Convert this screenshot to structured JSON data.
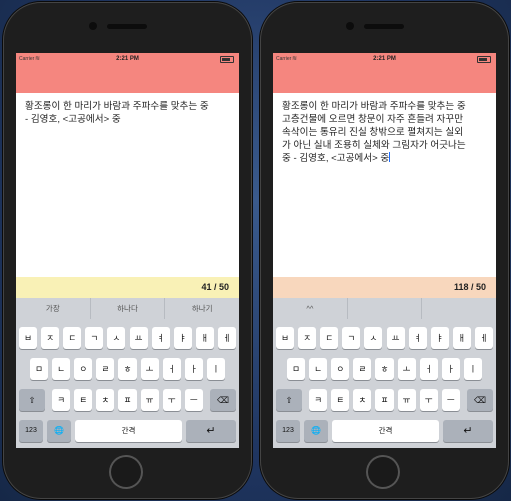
{
  "phones": [
    {
      "status": {
        "carrier": "Carrier",
        "time": "2:21 PM"
      },
      "text": "황조롱이 한 마리가 바람과 주파수를 맞추는 중\n- 김영호, <고공에서> 중",
      "counter": "41 / 50",
      "counter_color": "#f9f1b6",
      "suggestions": [
        "가장",
        "하나다",
        "하나기"
      ]
    },
    {
      "status": {
        "carrier": "Carrier",
        "time": "2:21 PM"
      },
      "text": "황조롱이 한 마리가 바람과 주파수를 맞추는 중\n고층건물에 오르면 창문이 자주 흔들려 자꾸만\n속삭이는 통유리 진실 창밖으로 펼쳐지는 실외\n가 아닌 실내 조용히 실체와 그림자가 어긋나는\n중 - 김영호, <고공에서> 중",
      "counter": "118 / 50",
      "counter_color": "#f8d7bd",
      "suggestions": [
        "^^",
        "",
        ""
      ]
    }
  ],
  "keyboard": {
    "row1": [
      "ㅂ",
      "ㅈ",
      "ㄷ",
      "ㄱ",
      "ㅅ",
      "ㅛ",
      "ㅕ",
      "ㅑ",
      "ㅐ",
      "ㅔ"
    ],
    "row2": [
      "ㅁ",
      "ㄴ",
      "ㅇ",
      "ㄹ",
      "ㅎ",
      "ㅗ",
      "ㅓ",
      "ㅏ",
      "ㅣ"
    ],
    "row3": [
      "ㅋ",
      "ㅌ",
      "ㅊ",
      "ㅍ",
      "ㅠ",
      "ㅜ",
      "ㅡ"
    ],
    "shift": "⇧",
    "delete": "⌫",
    "numbers": "123",
    "globe": "🌐",
    "space": "간격",
    "return": "↵"
  },
  "colors": {
    "status_bar": "#f5867f",
    "caret": "#1a6cff"
  }
}
